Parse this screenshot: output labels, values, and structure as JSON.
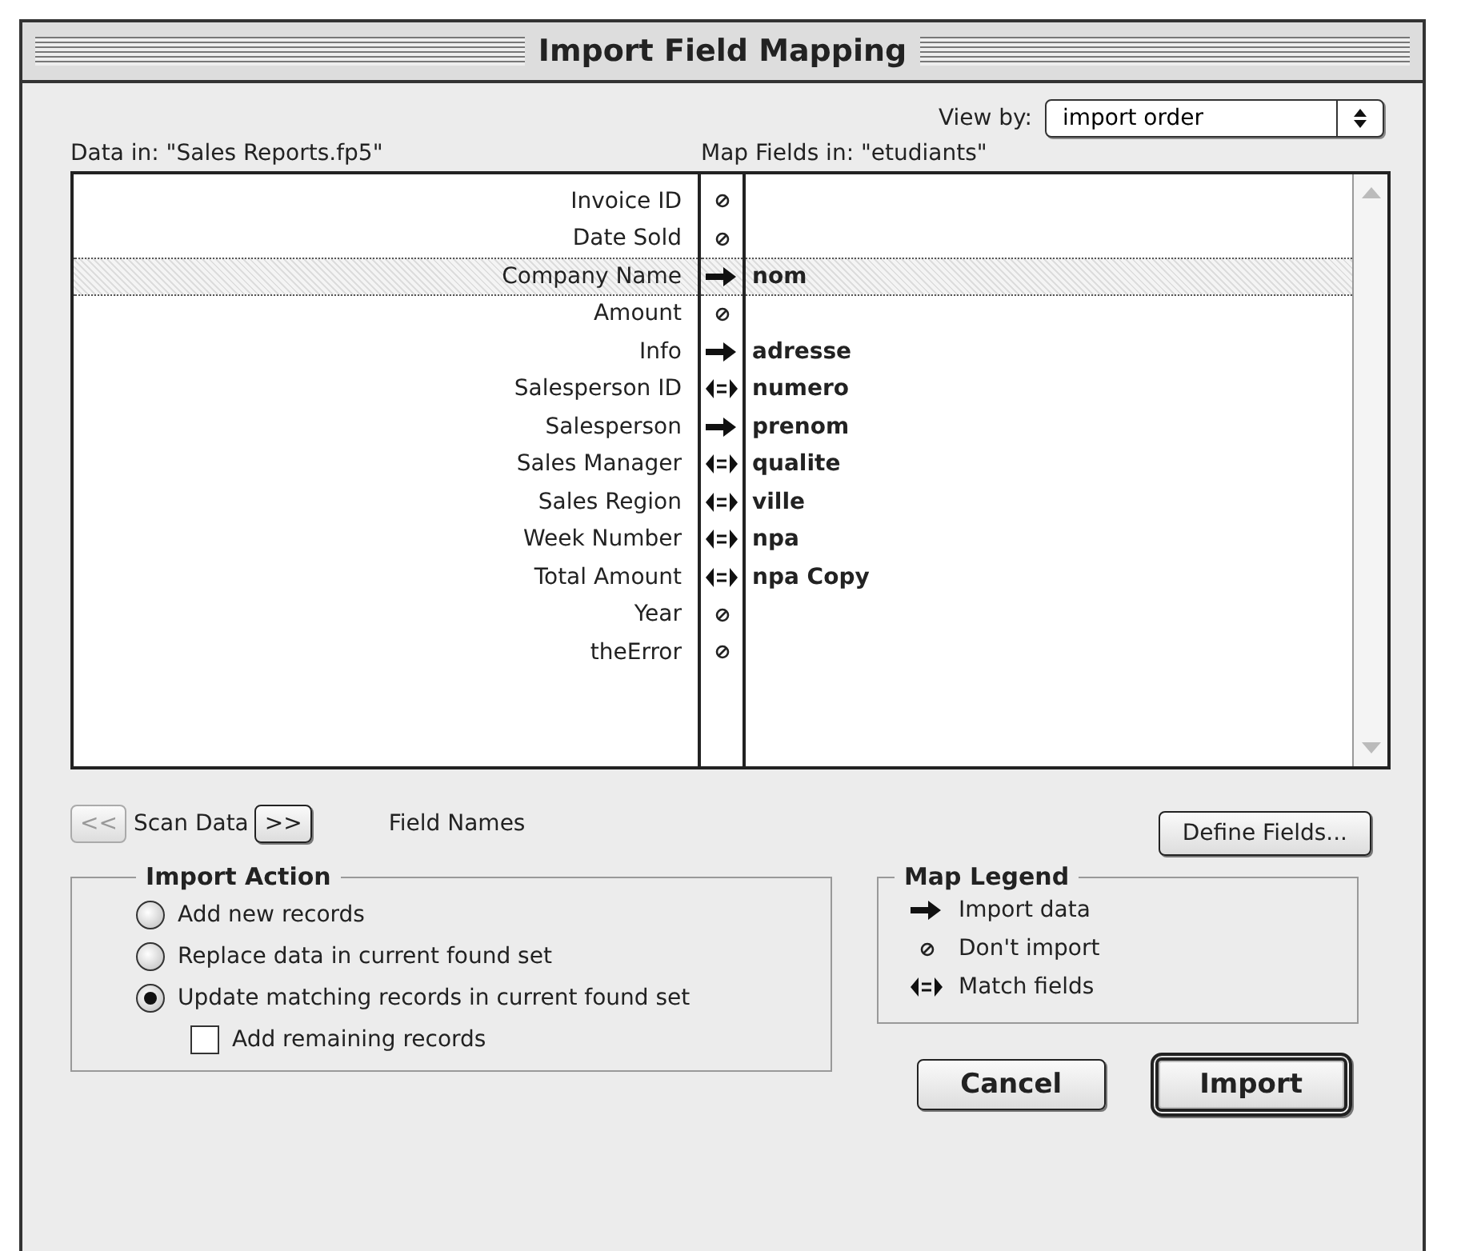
{
  "window": {
    "title": "Import Field Mapping"
  },
  "view_by": {
    "label": "View by:",
    "value": "import order"
  },
  "headers": {
    "data_in": "Data in: \"Sales Reports.fp5\"",
    "map": "Map",
    "fields_in": "Fields in: \"etudiants\""
  },
  "rows": [
    {
      "source": "Invoice ID",
      "kind": "skip",
      "selected": false
    },
    {
      "source": "Date Sold",
      "kind": "skip",
      "selected": false
    },
    {
      "source": "Company Name",
      "kind": "import",
      "target": "nom",
      "selected": true
    },
    {
      "source": "Amount",
      "kind": "skip",
      "selected": false
    },
    {
      "source": "Info",
      "kind": "import",
      "target": "adresse",
      "selected": false
    },
    {
      "source": "Salesperson ID",
      "kind": "match",
      "target": "numero",
      "selected": false
    },
    {
      "source": "Salesperson",
      "kind": "import",
      "target": "prenom",
      "selected": false
    },
    {
      "source": "Sales Manager",
      "kind": "match",
      "target": "qualite",
      "selected": false
    },
    {
      "source": "Sales Region",
      "kind": "match",
      "target": "ville",
      "selected": false
    },
    {
      "source": "Week Number",
      "kind": "match",
      "target": "npa",
      "selected": false
    },
    {
      "source": "Total Amount",
      "kind": "match",
      "target": "npa Copy",
      "selected": false
    },
    {
      "source": "Year",
      "kind": "skip",
      "selected": false
    },
    {
      "source": "theError",
      "kind": "skip",
      "selected": false
    }
  ],
  "scan": {
    "prev": {
      "label": "<<",
      "disabled": true
    },
    "label": "Scan Data",
    "next": {
      "label": ">>",
      "disabled": false
    },
    "mode": "Field Names"
  },
  "define_fields": "Define Fields...",
  "import_action": {
    "title": "Import Action",
    "options": [
      {
        "label": "Add new records",
        "selected": false
      },
      {
        "label": "Replace data in current found set",
        "selected": false
      },
      {
        "label": "Update matching records in current found set",
        "selected": true
      }
    ],
    "add_remaining": {
      "label": "Add remaining records",
      "checked": false
    }
  },
  "legend": {
    "title": "Map Legend",
    "items": [
      {
        "kind": "import",
        "label": "Import data"
      },
      {
        "kind": "skip",
        "label": "Don't import"
      },
      {
        "kind": "match",
        "label": "Match fields"
      }
    ]
  },
  "buttons": [
    {
      "label": "Cancel",
      "default": false
    },
    {
      "label": "Import",
      "default": true
    }
  ]
}
